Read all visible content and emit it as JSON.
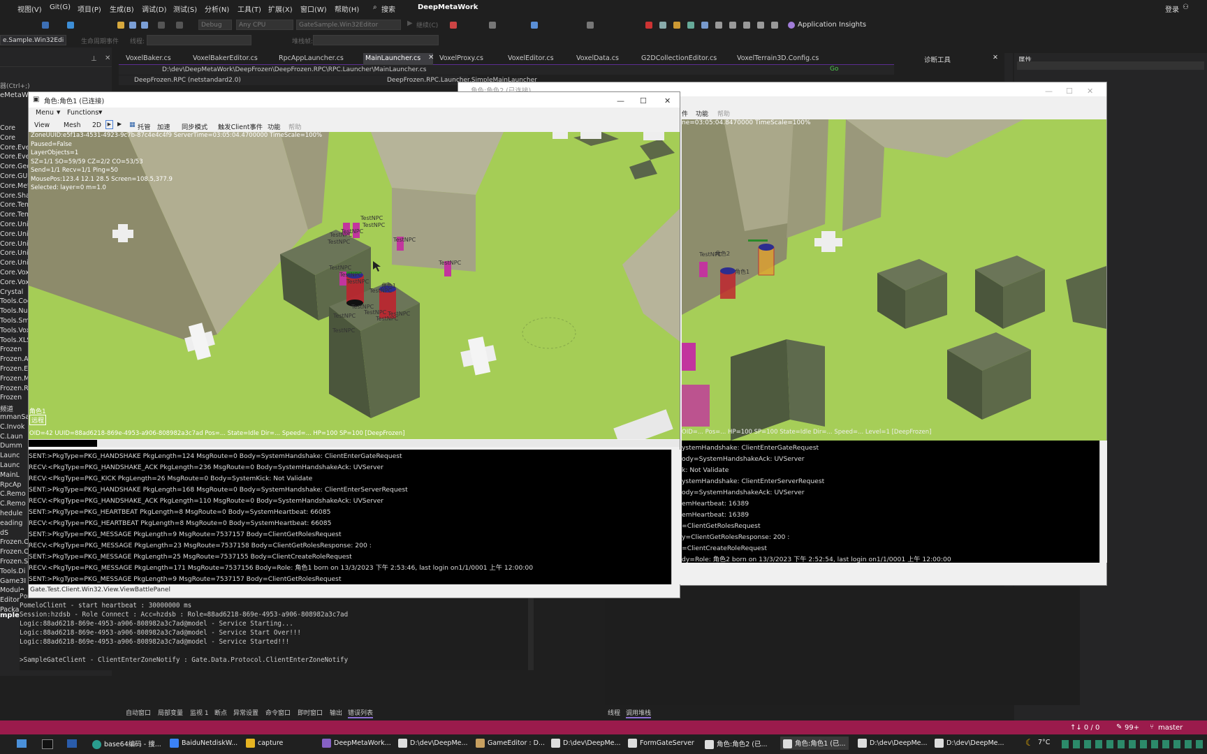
{
  "menubar": {
    "items": [
      "视图(V)",
      "Git(G)",
      "项目(P)",
      "生成(B)",
      "调试(D)",
      "测试(S)",
      "分析(N)",
      "工具(T)",
      "扩展(X)",
      "窗口(W)",
      "帮助(H)"
    ],
    "search": "搜索",
    "app_title": "DeepMetaWork",
    "login": "登录"
  },
  "toolbar": {
    "config": "Debug",
    "platform": "Any CPU",
    "startup": "GateSample.Win32Editor",
    "run": "继续(C)",
    "app_insights": "Application Insights"
  },
  "toolbar2": {
    "project_combo": "e.Sample.Win32Edi",
    "lifecycle": "生命周期事件",
    "thread_label": "线程:",
    "stackframe_label": "堆栈帧:"
  },
  "editor_tabs": [
    "VoxelBaker.cs",
    "VoxelBakerEditor.cs",
    "RpcAppLauncher.cs",
    "MainLauncher.cs",
    "VoxelProxy.cs",
    "VoxelEditor.cs",
    "VoxelData.cs",
    "G2DCollectionEditor.cs",
    "VoxelTerrain3D.Config.cs"
  ],
  "active_tab": "MainLauncher.cs",
  "path": "D:\\dev\\DeepMetaWork\\DeepFrozen\\DeepFrozen.RPC\\RPC.Launcher\\MainLauncher.cs",
  "go_label": "Go",
  "project_scope": "DeepFrozen.RPC (netstandard2.0)",
  "member_scope": "DeepFrozen.RPC.Launcher.SimpleMainLauncher",
  "diag_panel_title": "诊断工具",
  "props_panel_title": "属性",
  "left_panel": {
    "search": "器(Ctrl+;)",
    "root": "eMetaWork",
    "items": [
      "Core",
      "Core",
      "Core.Even",
      "Core.Even",
      "Core.Geor",
      "Core.GUI",
      "Core.Meta",
      "Core.Shar",
      "Core.Temp",
      "Core.Temp",
      "Core.Unity",
      "Core.Unity",
      "Core.Unity",
      "Core.Unity",
      "Core.Unity",
      "Core.Voxe",
      "Core.Voxe",
      "Crystal",
      "Tools.Cod",
      "Tools.NuG",
      "Tools.Sm",
      "Tools.Vox",
      "Tools.XLS",
      "Frozen",
      "Frozen.AS",
      "Frozen.ET",
      "Frozen.My",
      "Frozen.Re",
      "Frozen",
      "频道",
      "mmanSa",
      "C.Invok",
      "C.Laun",
      "Dumm",
      "Launc",
      "Launc",
      "MainL",
      "RpcAp",
      "C.Remo",
      "C.Remo",
      "hedule",
      "eading",
      "dS",
      "Frozen.C",
      "Frozen.C",
      "Frozen.Se",
      "Tools.Di",
      "Game3I",
      "Module",
      "Editor",
      "Package"
    ],
    "bottom": "mple.Win32Editor"
  },
  "window1": {
    "title": "角色:角色1   (已连接)",
    "menu": "Menu",
    "functions": "Functions",
    "toolbar": [
      "View",
      "Mesh",
      "2D",
      "托管",
      "加速",
      "同步模式",
      "触发Client事件",
      "功能",
      "帮助"
    ],
    "overlay": [
      "ZoneUUID:e5f1a3-4531-4923-9c7b-87c4e4c4f9 ServerTime=03:05:04.4700000 TimeScale=100%",
      "Paused=False",
      "LayerObjects=1",
      "SZ=1/1 SO=59/59 CZ=2/2 CO=53/53",
      "Send=1/1 Recv=1/1 Ping=50",
      "MousePos:123.4 12.1 28.5 Screen=108.5,377.9",
      "Selected: layer=0 m=1.0"
    ],
    "player_label": "角色1",
    "player_btn": "远程",
    "status_line": "OID=42 UUID=88ad6218-869e-4953-a906-808982a3c7ad Pos=... State=Idle Dir=... Speed=... HP=100 SP=100 [DeepFrozen]",
    "npc_label": "TestNPC",
    "role_label": "角色1",
    "log": [
      "SENT:>PkgType=PKG_HANDSHAKE PkgLength=124 MsgRoute=0 Body=SystemHandshake: ClientEnterGateRequest",
      "RECV:<PkgType=PKG_HANDSHAKE_ACK PkgLength=236 MsgRoute=0 Body=SystemHandshakeAck: UVServer",
      "RECV:<PkgType=PKG_KICK PkgLength=26 MsgRoute=0 Body=SystemKick: Not Validate",
      "SENT:>PkgType=PKG_HANDSHAKE PkgLength=168 MsgRoute=0 Body=SystemHandshake: ClientEnterServerRequest",
      "RECV:<PkgType=PKG_HANDSHAKE_ACK PkgLength=110 MsgRoute=0 Body=SystemHandshakeAck: UVServer",
      "SENT:>PkgType=PKG_HEARTBEAT PkgLength=8 MsgRoute=0 Body=SystemHeartbeat: 66085",
      "RECV:<PkgType=PKG_HEARTBEAT PkgLength=8 MsgRoute=0 Body=SystemHeartbeat: 66085",
      "SENT:>PkgType=PKG_MESSAGE PkgLength=9 MsgRoute=7537157 Body=ClientGetRolesRequest",
      "RECV:<PkgType=PKG_MESSAGE PkgLength=23 MsgRoute=7537158 Body=ClientGetRolesResponse: 200 :",
      "SENT:>PkgType=PKG_MESSAGE PkgLength=25 MsgRoute=7537155 Body=ClientCreateRoleRequest",
      "RECV:<PkgType=PKG_MESSAGE PkgLength=171 MsgRoute=7537156 Body=Role: 角色1      born on 13/3/2023 下午 2:53:46, last login on1/1/0001 上午 12:00:00",
      "SENT:>PkgType=PKG_MESSAGE PkgLength=9 MsgRoute=7537157 Body=ClientGetRolesRequest"
    ],
    "footer": "Gate.Test.Client.Win32.View.ViewBattlePanel"
  },
  "window2": {
    "title": "角色:角色2   (已连接)",
    "toolbar": [
      "件",
      "功能",
      "帮助"
    ],
    "overlay": "ne=03:05:04.8470000 TimeScale=100%",
    "status_line": "OID=... Pos=... HP=100 SP=100 State=Idle Dir=... Speed=... Level=1 [DeepFrozen]",
    "npc_label": "TestNPC",
    "role_label": "角色2",
    "role1_label": "角色1",
    "log": [
      "ystemHandshake: ClientEnterGateRequest",
      "ody=SystemHandshakeAck: UVServer",
      "k: Not Validate",
      "ystemHandshake: ClientEnterServerRequest",
      "ody=SystemHandshakeAck: UVServer",
      "emHeartbeat: 16389",
      "emHeartbeat: 16389",
      "=ClientGetRolesRequest",
      "y=ClientGetRolesResponse: 200 :",
      "=ClientCreateRoleRequest",
      "dy=Role: 角色2      born on 13/3/2023 下午 2:52:54, last login on1/1/0001 上午 12:00:00",
      "=ClientGetRolesRequest"
    ]
  },
  "console": [
    "PomeloClient - received handshake!",
    "PomeloClient - start heartbeat : 30000000 ms",
    "Session:hzdsb - Role Connect : Acc=hzdsb : Role=88ad6218-869e-4953-a906-808982a3c7ad",
    "Logic:88ad6218-869e-4953-a906-808982a3c7ad@model - Service Starting...",
    "Logic:88ad6218-869e-4953-a906-808982a3c7ad@model - Service Start Over!!!",
    "Logic:88ad6218-869e-4953-a906-808982a3c7ad@model - Service Started!!!",
    "",
    ">SampleGateClient - ClientEnterZoneNotify : Gate.Data.Protocol.ClientEnterZoneNotify"
  ],
  "bottom_tabs": [
    "自动窗口",
    "局部变量",
    "监视 1",
    "断点",
    "异常设置",
    "命令窗口",
    "即时窗口",
    "输出",
    "错误列表"
  ],
  "bottom_tabs_right": [
    "线程",
    "调用堆栈"
  ],
  "statusbar": {
    "lines": "↑↓ 0 / 0",
    "errors": "99+",
    "branch": "master"
  },
  "taskbar": {
    "items": [
      "base64编码 - 搜...",
      "BaiduNetdiskW...",
      "capture",
      "DeepMetaWork...",
      "D:\\dev\\DeepMe...",
      "GameEditor : D...",
      "D:\\dev\\DeepMe...",
      "FormGateServer",
      "角色:角色2  (已...",
      "角色:角色1  (已...",
      "D:\\dev\\DeepMe...",
      "D:\\dev\\DeepMe..."
    ],
    "temp": "7°C"
  }
}
